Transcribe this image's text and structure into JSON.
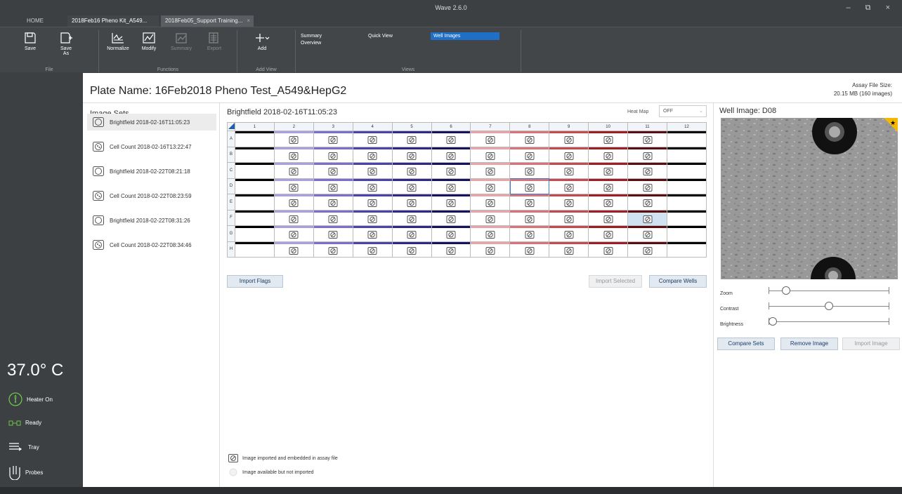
{
  "window": {
    "title": "Wave 2.6.0",
    "controls": "– ⧉ ×"
  },
  "tabs": [
    {
      "label": "HOME"
    },
    {
      "label": "2018Feb16 Pheno Kit_A549..."
    },
    {
      "label": "2018Feb05_Support Training..."
    }
  ],
  "ribbon": {
    "file": {
      "save": "Save",
      "save_as_1": "Save",
      "save_as_2": "As",
      "group": "File"
    },
    "functions": {
      "normalize": "Normalize",
      "modify": "Modify",
      "summary": "Summary",
      "export": "Export",
      "group": "Functions"
    },
    "add_view": {
      "add": "Add",
      "group": "Add View"
    },
    "views": {
      "summary": "Summary",
      "overview": "Overview",
      "quick_view": "Quick View",
      "well_images": "Well Images",
      "group": "Views"
    }
  },
  "sidebar": {
    "temperature": "37.0° C",
    "heater": "Heater On",
    "ready": "Ready",
    "tray": "Tray",
    "probes": "Probes"
  },
  "plate": {
    "name": "Plate Name:  16Feb2018 Pheno Test_A549&HepG2",
    "assay_size_label": "Assay File Size:",
    "assay_size_value": "20.15 MB  (160 images)"
  },
  "image_sets": {
    "title": "Image Sets",
    "items": [
      {
        "label": "Brightfield 2018-02-16T11:05:23",
        "type": "brightfield",
        "selected": true
      },
      {
        "label": "Cell Count 2018-02-16T13:22:47",
        "type": "cellcount",
        "selected": false
      },
      {
        "label": "Brightfield 2018-02-22T08:21:18",
        "type": "brightfield",
        "selected": false
      },
      {
        "label": "Cell Count 2018-02-22T08:23:59",
        "type": "cellcount",
        "selected": false
      },
      {
        "label": "Brightfield 2018-02-22T08:31:26",
        "type": "brightfield",
        "selected": false
      },
      {
        "label": "Cell Count 2018-02-22T08:34:46",
        "type": "cellcount",
        "selected": false
      }
    ]
  },
  "grid": {
    "title": "Brightfield 2018-02-16T11:05:23",
    "heatmap_label": "Heat Map",
    "heatmap_value": "OFF",
    "columns": [
      "1",
      "2",
      "3",
      "4",
      "5",
      "6",
      "7",
      "8",
      "9",
      "10",
      "11",
      "12"
    ],
    "rows": [
      "A",
      "B",
      "C",
      "D",
      "E",
      "F",
      "G",
      "H"
    ],
    "column_colors": [
      "#000000",
      "#a9a0e0",
      "#7a70cc",
      "#4b44a8",
      "#2f2a8a",
      "#151260",
      "#e8a4a8",
      "#d8737a",
      "#c44a52",
      "#9e1e26",
      "#5c0d12",
      "#000000"
    ],
    "imaged_columns": [
      "2",
      "3",
      "4",
      "5",
      "6",
      "7",
      "8",
      "9",
      "10",
      "11"
    ],
    "selected_well": "D8",
    "highlighted_well": "F11",
    "import_flags": "Import Flags",
    "import_selected": "Import Selected",
    "compare_wells": "Compare Wells",
    "legend_imported": "Image imported and embedded in assay file",
    "legend_available": "Image available but not imported"
  },
  "well_image": {
    "title": "Well Image: D08",
    "zoom_label": "Zoom",
    "contrast_label": "Contrast",
    "brightness_label": "Brightness",
    "zoom": 0.12,
    "contrast": 0.5,
    "brightness": 0.0,
    "compare_sets": "Compare Sets",
    "remove_image": "Remove Image",
    "import_image": "Import Image"
  },
  "colors": {
    "accent": "#1f6fc9",
    "flag": "#f5b800"
  }
}
